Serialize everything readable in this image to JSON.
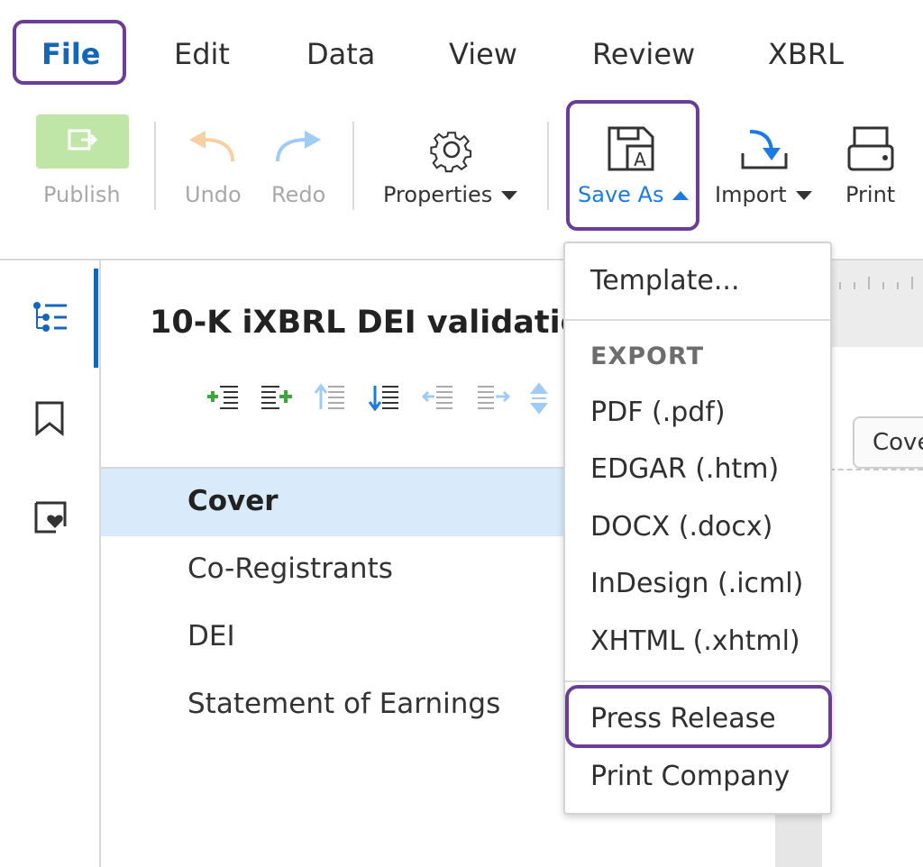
{
  "menu": {
    "file": "File",
    "edit": "Edit",
    "data": "Data",
    "view": "View",
    "review": "Review",
    "xbrl": "XBRL"
  },
  "toolbar": {
    "publish": "Publish",
    "undo": "Undo",
    "redo": "Redo",
    "properties": "Properties",
    "save_as": "Save As",
    "import": "Import",
    "print": "Print"
  },
  "document": {
    "title": "10-K iXBRL DEI validatio",
    "sections": [
      "Cover",
      "Co-Registrants",
      "DEI",
      "Statement of Earnings"
    ],
    "selected_section": "Cover",
    "tab_label": "Cove"
  },
  "save_as_menu": {
    "template": "Template...",
    "export_header": "EXPORT",
    "items": [
      "PDF (.pdf)",
      "EDGAR (.htm)",
      "DOCX (.docx)",
      "InDesign (.icml)",
      "XHTML (.xhtml)"
    ],
    "press_release": "Press Release",
    "print_company": "Print Company"
  },
  "colors": {
    "highlight_outline": "#6a3d98",
    "accent_blue": "#1466b8",
    "selected_row": "#d9eafb",
    "publish_green": "#bfe6a6"
  },
  "icons": {
    "publish": "publish-icon",
    "undo": "undo-icon",
    "redo": "redo-icon",
    "properties": "gear-icon",
    "save_as": "save-as-icon",
    "import": "import-icon",
    "print": "print-icon",
    "outline": "outline-icon",
    "bookmark": "bookmark-icon",
    "favorites": "favorites-icon"
  }
}
